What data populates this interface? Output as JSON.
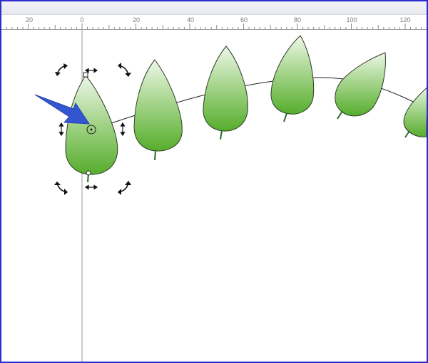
{
  "ruler": {
    "labels": [
      "20",
      "0",
      "20",
      "40",
      "60",
      "80",
      "100",
      "120"
    ]
  },
  "colors": {
    "window_border": "#2b2bd0",
    "leaf_top": "#e9f5e3",
    "leaf_bottom": "#5fb535",
    "leaf_stroke": "#2d3d26",
    "stem": "#2a6a2a",
    "arrow": "#3356d0"
  },
  "icons": {
    "rotate_handle": "curved-double-arrow",
    "skew_handle": "double-arrow",
    "pointer": "blue-arrow"
  }
}
